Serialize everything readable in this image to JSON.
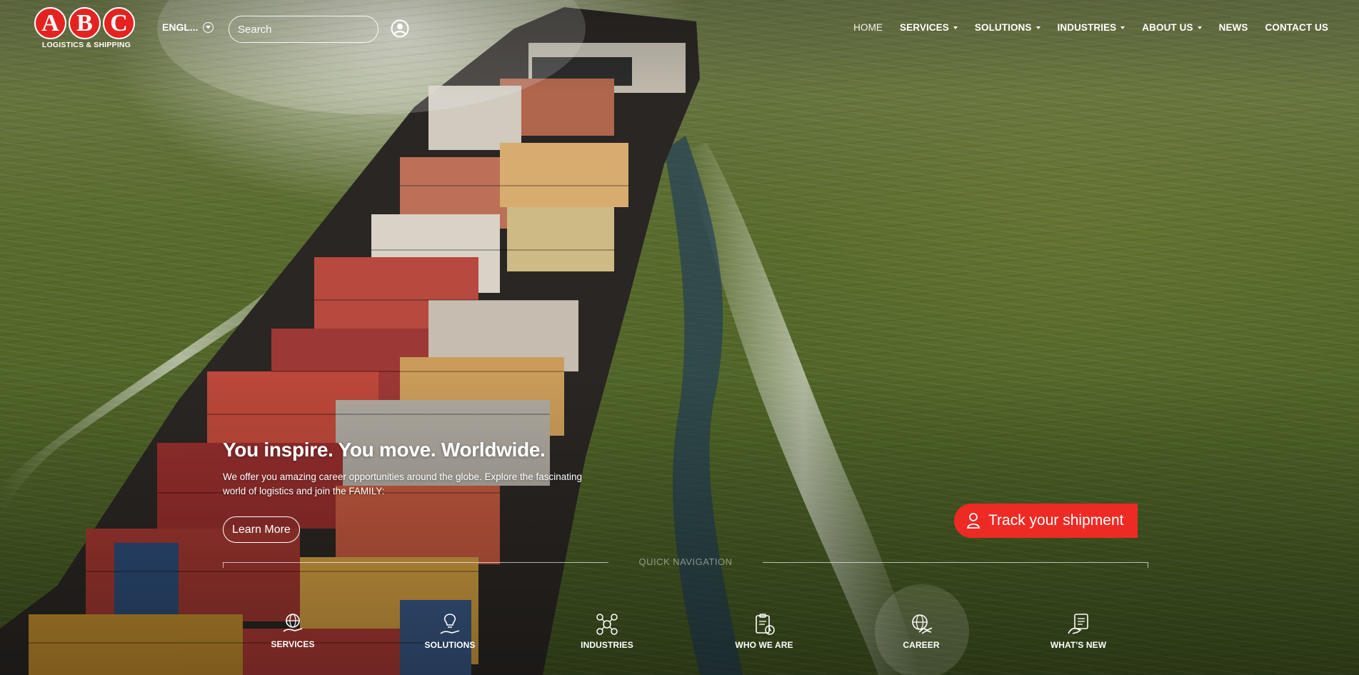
{
  "brand": {
    "letters": [
      "A",
      "B",
      "C"
    ],
    "subtitle": "LOGISTICS & SHIPPING",
    "accent_color": "#e42321"
  },
  "header": {
    "language": "ENGL...",
    "search_placeholder": "Search",
    "nav": [
      {
        "label": "HOME",
        "dropdown": false,
        "active": true
      },
      {
        "label": "SERVICES",
        "dropdown": true
      },
      {
        "label": "SOLUTIONS",
        "dropdown": true
      },
      {
        "label": "INDUSTRIES",
        "dropdown": true
      },
      {
        "label": "ABOUT US",
        "dropdown": true
      },
      {
        "label": "NEWS",
        "dropdown": false
      },
      {
        "label": "CONTACT US",
        "dropdown": false
      }
    ]
  },
  "hero": {
    "headline": "You inspire. You move. Worldwide.",
    "body": "We offer you amazing career opportunities around the globe. Explore the fascinating world of logistics and join the FAMILY:",
    "cta_label": "Learn More"
  },
  "track": {
    "label": "Track your shipment",
    "icon": "person-pin-icon",
    "color": "#ee2a24"
  },
  "quick_nav": {
    "title": "QUICK NAVIGATION",
    "items": [
      {
        "label": "SERVICES",
        "icon": "globe-hand-icon"
      },
      {
        "label": "SOLUTIONS",
        "icon": "lightbulb-hand-icon"
      },
      {
        "label": "INDUSTRIES",
        "icon": "network-icon"
      },
      {
        "label": "WHO WE ARE",
        "icon": "clipboard-clock-icon"
      },
      {
        "label": "CAREER",
        "icon": "globe-handshake-icon",
        "highlighted": true
      },
      {
        "label": "WHAT'S NEW",
        "icon": "news-hand-icon"
      }
    ]
  }
}
